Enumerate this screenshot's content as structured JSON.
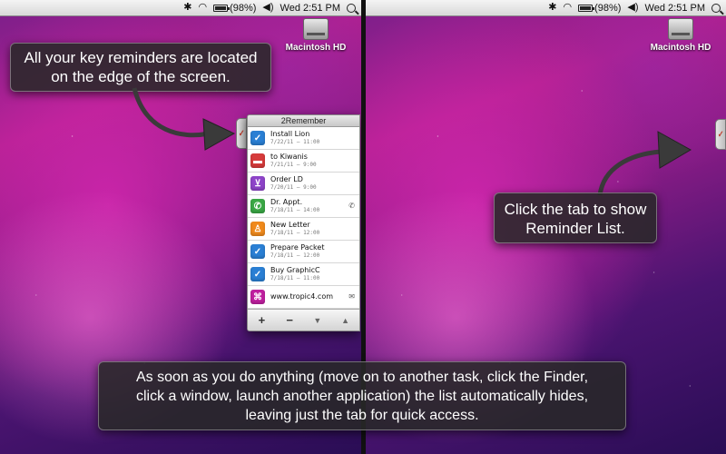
{
  "menubar": {
    "battery_percent": "(98%)",
    "battery_level": 0.98,
    "clock": "Wed 2:51 PM",
    "icons": [
      "bluetooth-icon",
      "wifi-icon",
      "battery-icon",
      "volume-icon",
      "spotlight-search-icon"
    ]
  },
  "desktop": {
    "drive_label": "Macintosh HD"
  },
  "callouts": {
    "edge": {
      "line1": "All your key reminders are located",
      "line2": "on the edge of the screen."
    },
    "tab": {
      "line1": "Click the tab to show",
      "line2": "Reminder List."
    },
    "bottom": {
      "line1": "As soon as you do anything (move on to another task, click the Finder,",
      "line2": "click a window, launch another application) the list automatically hides,",
      "line3": "leaving just the tab for quick access."
    }
  },
  "panel": {
    "title": "2Remember",
    "items": [
      {
        "title": "Install Lion",
        "date": "7/22/11 — 11:00",
        "icon": "checkmark-icon",
        "color": "#2a7fd4"
      },
      {
        "title": "to Kiwanis",
        "date": "7/21/11 — 9:00",
        "icon": "car-icon",
        "color": "#d63b3b"
      },
      {
        "title": "Order LD",
        "date": "7/20/11 — 9:00",
        "icon": "cart-icon",
        "color": "#8e44c9"
      },
      {
        "title": "Dr. Appt.",
        "date": "7/18/11 — 14:00",
        "icon": "phone-icon",
        "color": "#3aa845",
        "extra": "phone-icon"
      },
      {
        "title": "New Letter",
        "date": "7/18/11 — 12:00",
        "icon": "person-icon",
        "color": "#f08a1c"
      },
      {
        "title": "Prepare Packet",
        "date": "7/18/11 — 12:00",
        "icon": "checkmark-icon",
        "color": "#2a7fd4"
      },
      {
        "title": "Buy GraphicC",
        "date": "7/18/11 — 11:00",
        "icon": "checkmark-icon",
        "color": "#2a7fd4"
      },
      {
        "title": "www.tropic4.com",
        "date": "",
        "icon": "link-icon",
        "color": "#c020a0",
        "extra": "mail-icon"
      }
    ],
    "toolbar": {
      "add": "+",
      "remove": "−",
      "down": "▼",
      "up": "▲"
    }
  }
}
